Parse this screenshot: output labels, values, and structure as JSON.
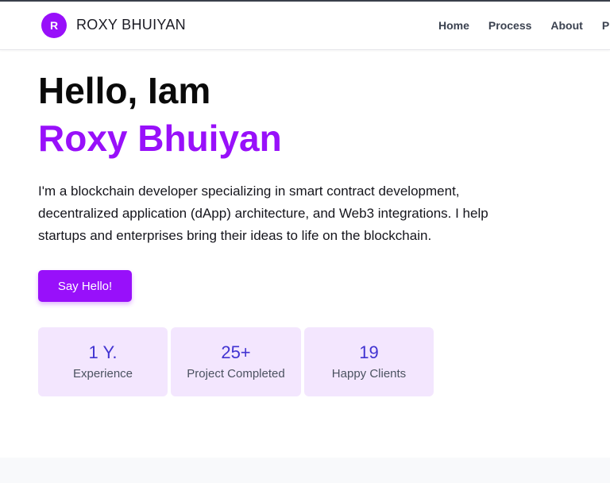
{
  "header": {
    "logo_letter": "R",
    "brand": "ROXY BHUIYAN",
    "nav": [
      "Home",
      "Process",
      "About",
      "Pro"
    ]
  },
  "hero": {
    "greeting": "Hello, Iam",
    "name": "Roxy Bhuiyan",
    "bio": "I'm a blockchain developer specializing in smart contract development, decentralized application (dApp) architecture, and Web3 integrations. I help startups and enterprises bring their ideas to life on the blockchain.",
    "cta": "Say Hello!"
  },
  "stats": [
    {
      "value": "1 Y.",
      "label": "Experience"
    },
    {
      "value": "25+",
      "label": "Project Completed"
    },
    {
      "value": "19",
      "label": "Happy Clients"
    }
  ],
  "colors": {
    "accent": "#9810fa",
    "stat_value": "#4133d1",
    "stat_bg": "#f3e6fe"
  }
}
